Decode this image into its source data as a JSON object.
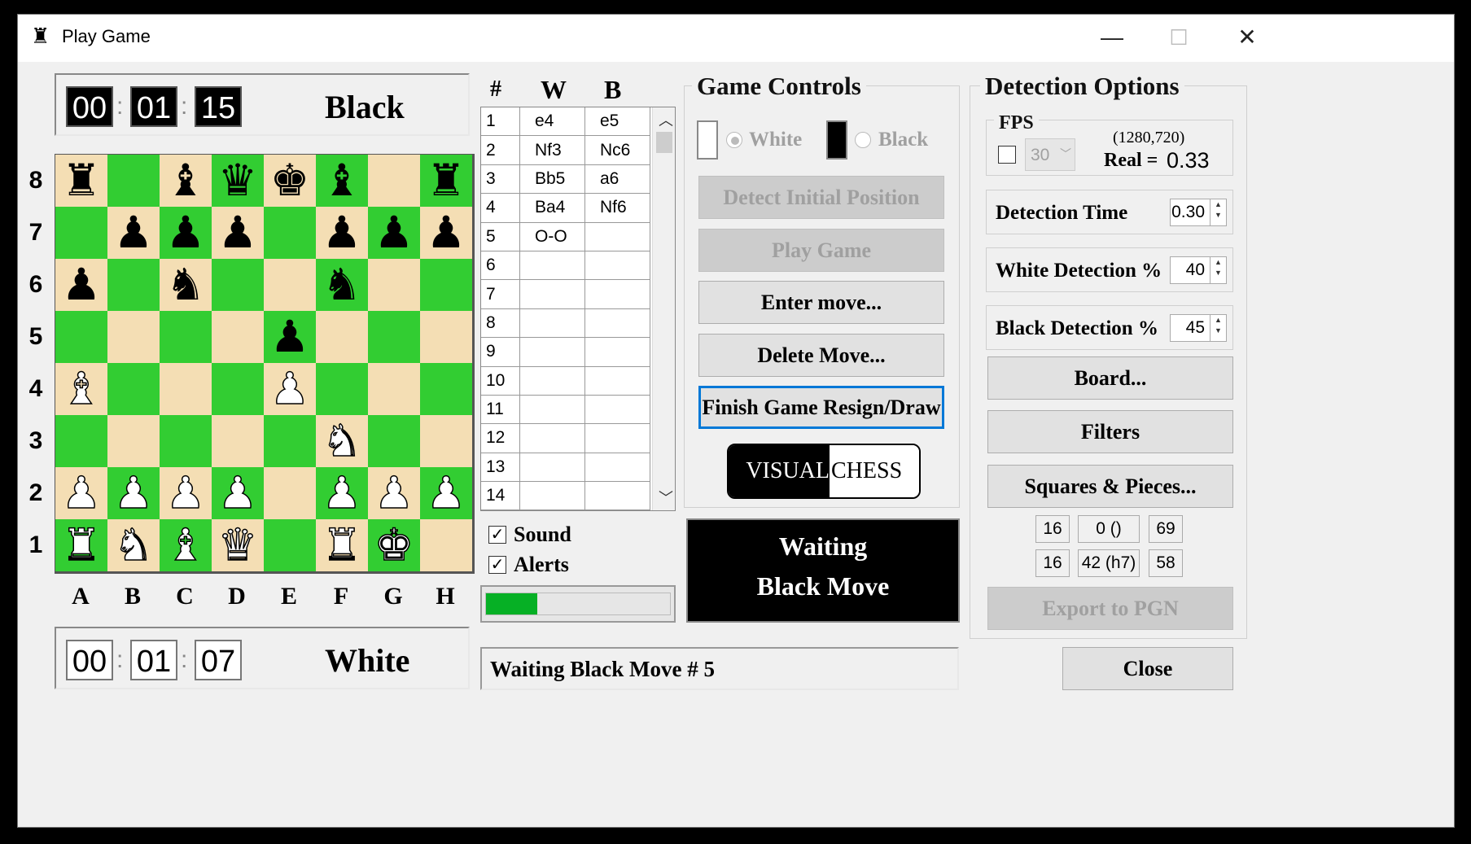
{
  "window": {
    "title": "Play Game",
    "app_icon": "rook-icon",
    "minimize": "—",
    "maximize": "☐",
    "close": "✕"
  },
  "clocks": {
    "black": {
      "h": "00",
      "m": "01",
      "s": "15",
      "label": "Black"
    },
    "white": {
      "h": "00",
      "m": "01",
      "s": "07",
      "label": "White"
    },
    "colon": ":"
  },
  "board": {
    "ranks": [
      "8",
      "7",
      "6",
      "5",
      "4",
      "3",
      "2",
      "1"
    ],
    "files": [
      "A",
      "B",
      "C",
      "D",
      "E",
      "F",
      "G",
      "H"
    ],
    "light_color": "#f4deb4",
    "dark_color": "#32cd32",
    "rows": [
      [
        "r",
        "",
        "b",
        "q",
        "k",
        "b",
        "",
        "r"
      ],
      [
        "",
        "p",
        "p",
        "p",
        "",
        "p",
        "p",
        "p"
      ],
      [
        "p",
        "",
        "n",
        "",
        "",
        "n",
        "",
        ""
      ],
      [
        "",
        "",
        "",
        "",
        "p",
        "",
        "",
        ""
      ],
      [
        "B",
        "",
        "",
        "",
        "P",
        "",
        "",
        ""
      ],
      [
        "",
        "",
        "",
        "",
        "",
        "N",
        "",
        ""
      ],
      [
        "P",
        "P",
        "P",
        "P",
        "",
        "P",
        "P",
        "P"
      ],
      [
        "R",
        "N",
        "B",
        "Q",
        "",
        "R",
        "K",
        ""
      ]
    ],
    "colors": [
      [
        "l",
        "d",
        "l",
        "d",
        "l",
        "d",
        "l",
        "d"
      ],
      [
        "d",
        "l",
        "d",
        "l",
        "d",
        "l",
        "d",
        "l"
      ],
      [
        "l",
        "d",
        "l",
        "d",
        "l",
        "d",
        "l",
        "d"
      ],
      [
        "d",
        "l",
        "d",
        "l",
        "d",
        "l",
        "d",
        "l"
      ],
      [
        "l",
        "d",
        "l",
        "d",
        "l",
        "d",
        "l",
        "d"
      ],
      [
        "d",
        "l",
        "d",
        "l",
        "d",
        "l",
        "d",
        "l"
      ],
      [
        "l",
        "d",
        "l",
        "d",
        "l",
        "d",
        "l",
        "d"
      ],
      [
        "d",
        "l",
        "d",
        "l",
        "d",
        "l",
        "d",
        "l"
      ]
    ]
  },
  "moves": {
    "headers": [
      "#",
      "W",
      "B"
    ],
    "rows": [
      [
        "1",
        "e4",
        "e5"
      ],
      [
        "2",
        "Nf3",
        "Nc6"
      ],
      [
        "3",
        "Bb5",
        "a6"
      ],
      [
        "4",
        "Ba4",
        "Nf6"
      ],
      [
        "5",
        "O-O",
        ""
      ],
      [
        "6",
        "",
        ""
      ],
      [
        "7",
        "",
        ""
      ],
      [
        "8",
        "",
        ""
      ],
      [
        "9",
        "",
        ""
      ],
      [
        "10",
        "",
        ""
      ],
      [
        "11",
        "",
        ""
      ],
      [
        "12",
        "",
        ""
      ],
      [
        "13",
        "",
        ""
      ],
      [
        "14",
        "",
        ""
      ]
    ]
  },
  "options": {
    "sound_label": "Sound",
    "sound_checked": true,
    "alerts_label": "Alerts",
    "alerts_checked": true
  },
  "progress": {
    "value": 0.28,
    "color": "#06b025"
  },
  "status_bar": "Waiting Black Move # 5",
  "game_controls": {
    "title": "Game Controls",
    "white_label": "White",
    "black_label": "Black",
    "detect_initial": "Detect Initial Position",
    "play_game": "Play Game",
    "enter_move": "Enter move...",
    "delete_move": "Delete Move...",
    "finish_game": "Finish Game Resign/Draw",
    "logo_left": "VISUAL",
    "logo_right": "CHESS"
  },
  "status_panel": {
    "line1": "Waiting",
    "line2": "Black Move"
  },
  "detection": {
    "title": "Detection Options",
    "fps_title": "FPS",
    "fps_value": "30",
    "resolution": "(1280,720)",
    "real_label": "Real =",
    "real_value": "0.33",
    "detection_time_label": "Detection Time",
    "detection_time_value": "0.30",
    "white_detection_label": "White Detection %",
    "white_detection_value": "40",
    "black_detection_label": "Black Detection %",
    "black_detection_value": "45",
    "board_button": "Board...",
    "filters_button": "Filters",
    "squares_button": "Squares & Pieces...",
    "stats_row1": [
      "16",
      "0 ()",
      "69"
    ],
    "stats_row2": [
      "16",
      "42 (h7)",
      "58"
    ],
    "export_button": "Export to PGN"
  },
  "close_button": "Close"
}
